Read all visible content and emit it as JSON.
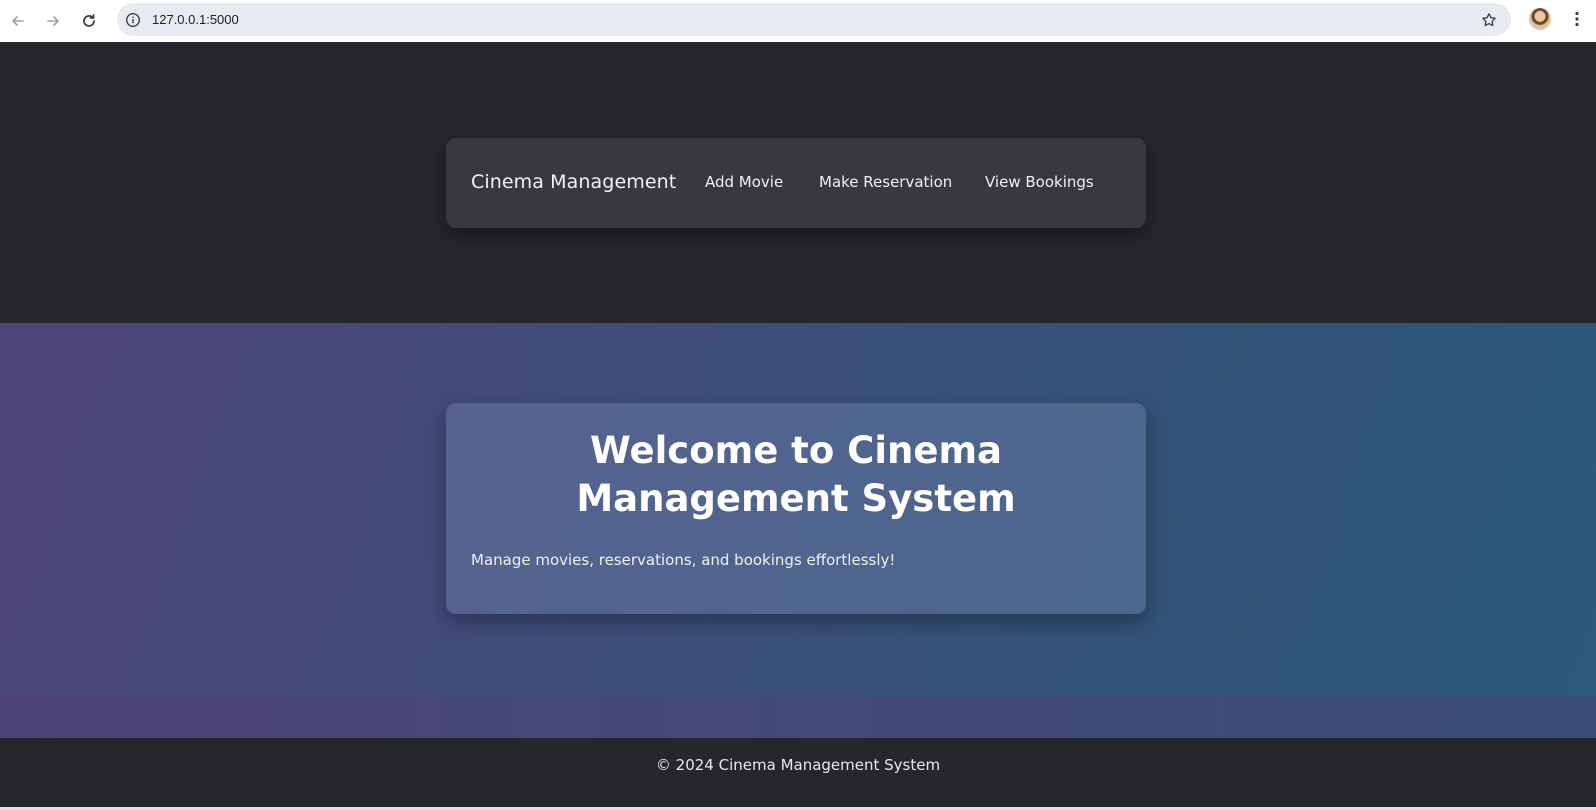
{
  "browser": {
    "url": "127.0.0.1:5000",
    "icons": {
      "back": "arrow-left-icon",
      "forward": "arrow-right-icon",
      "reload": "reload-icon",
      "site_info": "info-icon",
      "bookmark": "star-icon",
      "menu": "kebab-menu-icon"
    }
  },
  "navbar": {
    "brand": "Cinema Management",
    "links": [
      "Add Movie",
      "Make Reservation",
      "View Bookings"
    ]
  },
  "hero": {
    "title": "Welcome to Cinema Management System",
    "subtitle": "Manage movies, reservations, and bookings effortlessly!"
  },
  "footer": {
    "text": "© 2024 Cinema Management System"
  },
  "colors": {
    "header_bg": "#26272c",
    "navbar_bg": "#38393e",
    "hero_gradient_start": "#4f4579",
    "hero_gradient_end": "#2b5a7b",
    "text": "#ffffff"
  }
}
